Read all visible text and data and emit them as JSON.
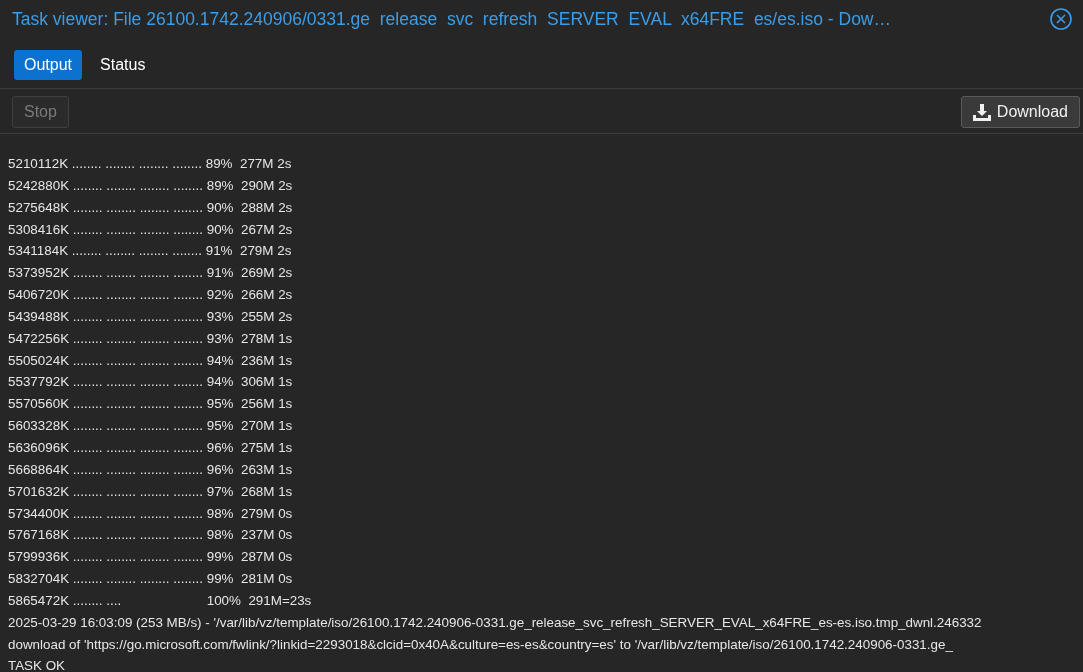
{
  "window": {
    "title": "Task viewer: File 26100.1742.240906/0331.ge  release  svc  refresh  SERVER  EVAL  x64FRE  es/es.iso - Dow…"
  },
  "tabs": [
    {
      "label": "Output",
      "selected": true
    },
    {
      "label": "Status",
      "selected": false
    }
  ],
  "toolbar": {
    "stop": {
      "label": "Stop",
      "disabled": true
    },
    "download": {
      "label": "Download",
      "disabled": false
    }
  },
  "log": [
    "5210112K ........ ........ ........ ........ 89%  277M 2s",
    "5242880K ........ ........ ........ ........ 89%  290M 2s",
    "5275648K ........ ........ ........ ........ 90%  288M 2s",
    "5308416K ........ ........ ........ ........ 90%  267M 2s",
    "5341184K ........ ........ ........ ........ 91%  279M 2s",
    "5373952K ........ ........ ........ ........ 91%  269M 2s",
    "5406720K ........ ........ ........ ........ 92%  266M 2s",
    "5439488K ........ ........ ........ ........ 93%  255M 2s",
    "5472256K ........ ........ ........ ........ 93%  278M 1s",
    "5505024K ........ ........ ........ ........ 94%  236M 1s",
    "5537792K ........ ........ ........ ........ 94%  306M 1s",
    "5570560K ........ ........ ........ ........ 95%  256M 1s",
    "5603328K ........ ........ ........ ........ 95%  270M 1s",
    "5636096K ........ ........ ........ ........ 96%  275M 1s",
    "5668864K ........ ........ ........ ........ 96%  263M 1s",
    "5701632K ........ ........ ........ ........ 97%  268M 1s",
    "5734400K ........ ........ ........ ........ 98%  279M 0s",
    "5767168K ........ ........ ........ ........ 98%  237M 0s",
    "5799936K ........ ........ ........ ........ 99%  287M 0s",
    "5832704K ........ ........ ........ ........ 99%  281M 0s",
    "5865472K ........ ....                       100%  291M=23s",
    "2025-03-29 16:03:09 (253 MB/s) - '/var/lib/vz/template/iso/26100.1742.240906-0331.ge_release_svc_refresh_SERVER_EVAL_x64FRE_es-es.iso.tmp_dwnl.246332",
    "download of 'https://go.microsoft.com/fwlink/?linkid=2293018&clcid=0x40A&culture=es-es&country=es' to '/var/lib/vz/template/iso/26100.1742.240906-0331.ge_",
    "TASK OK"
  ]
}
